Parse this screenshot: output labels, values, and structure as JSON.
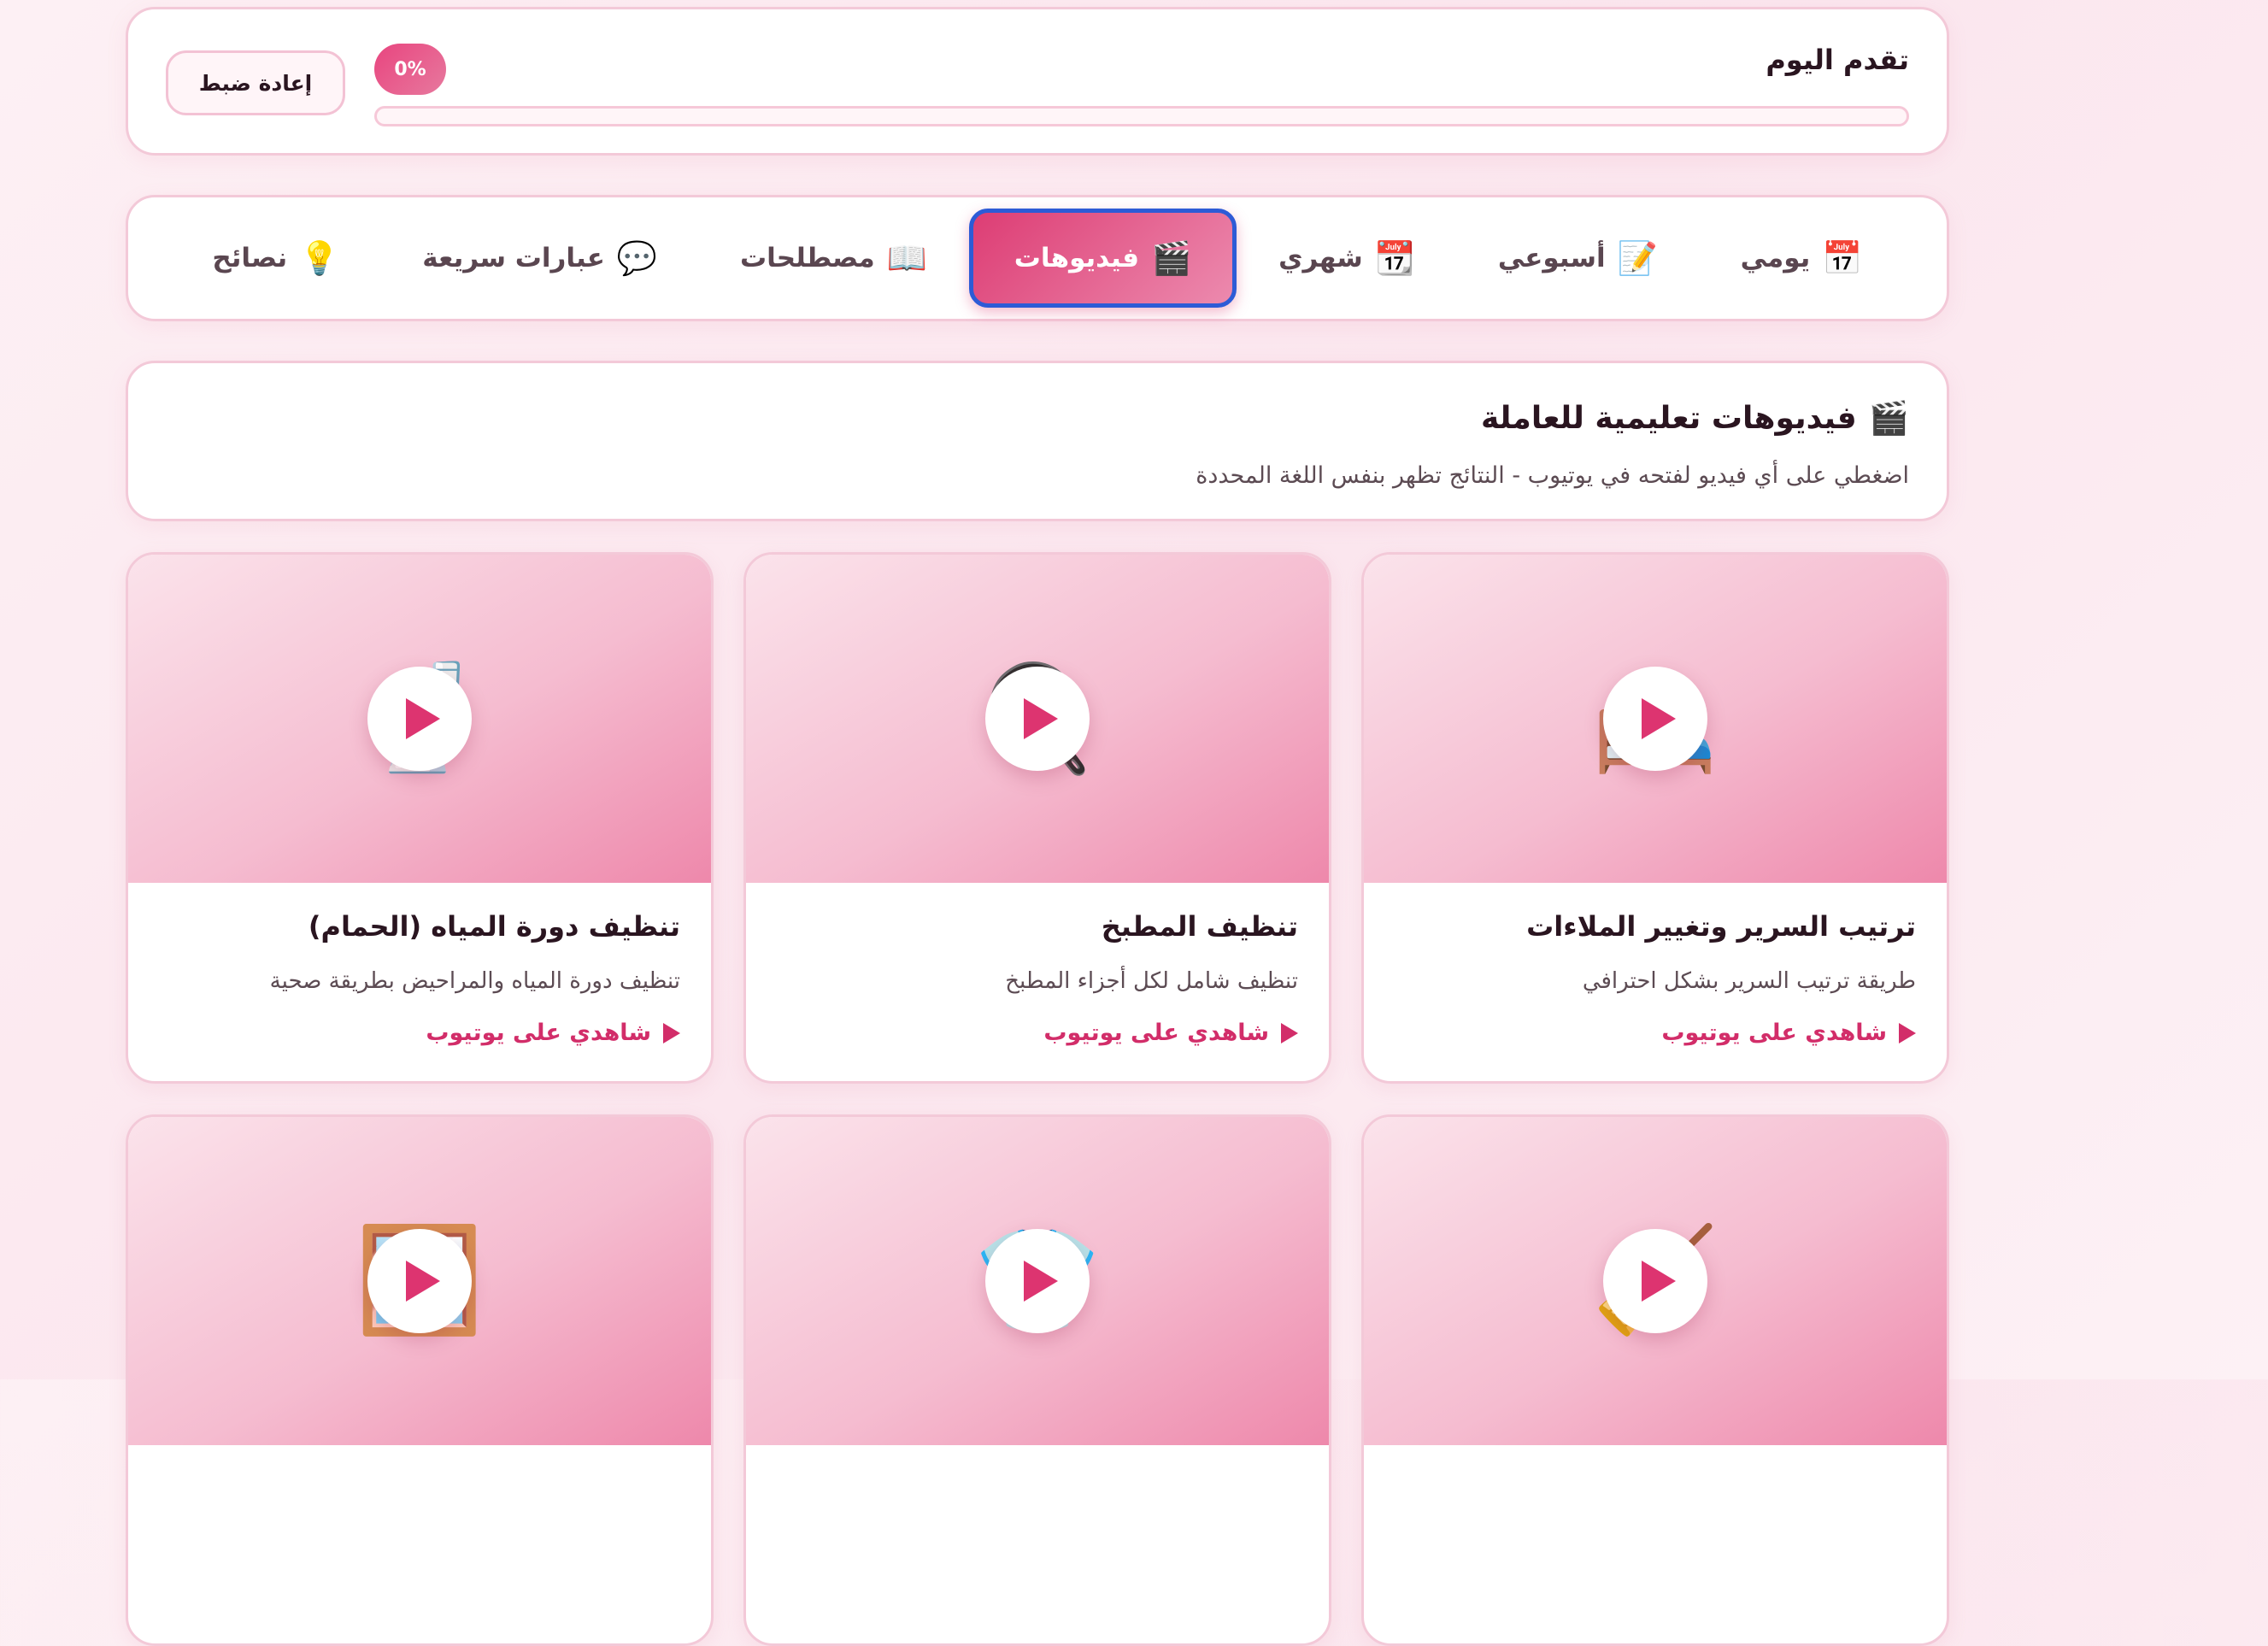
{
  "progress": {
    "title": "تقدم اليوم",
    "percent_label": "0%",
    "value": 0,
    "reset_label": "إعادة ضبط"
  },
  "tabs": [
    {
      "icon": "📅",
      "label": "يومي"
    },
    {
      "icon": "📝",
      "label": "أسبوعي"
    },
    {
      "icon": "📆",
      "label": "شهري"
    },
    {
      "icon": "🎬",
      "label": "فيديوهات"
    },
    {
      "icon": "📖",
      "label": "مصطلحات"
    },
    {
      "icon": "💬",
      "label": "عبارات سريعة"
    },
    {
      "icon": "💡",
      "label": "نصائح"
    }
  ],
  "active_tab": "فيديوهات",
  "section": {
    "icon": "🎬",
    "title": "فيديوهات تعليمية للعاملة",
    "description": "اضغطي على أي فيديو لفتحه في يوتيوب - النتائج تظهر بنفس اللغة المحددة"
  },
  "videos": [
    {
      "emoji": "🛏️",
      "title": "ترتيب السرير وتغيير الملاءات",
      "description": "طريقة ترتيب السرير بشكل احترافي",
      "link": "شاهدي على يوتيوب"
    },
    {
      "emoji": "🍳",
      "title": "تنظيف المطبخ",
      "description": "تنظيف شامل لكل أجزاء المطبخ",
      "link": "شاهدي على يوتيوب"
    },
    {
      "emoji": "🚽",
      "title": "تنظيف دورة المياه (الحمام)",
      "description": "تنظيف دورة المياه والمراحيض بطريقة صحية",
      "link": "شاهدي على يوتيوب"
    },
    {
      "emoji": "🧹",
      "title": "",
      "description": "",
      "link": ""
    },
    {
      "emoji": "👕",
      "title": "",
      "description": "",
      "link": ""
    },
    {
      "emoji": "🪟",
      "title": "",
      "description": "",
      "link": ""
    }
  ],
  "colors": {
    "accent": "#dd3470",
    "active_tab_border": "#2d5bd6",
    "card_border": "#f3c9d8",
    "background": "#fbe6ee"
  }
}
